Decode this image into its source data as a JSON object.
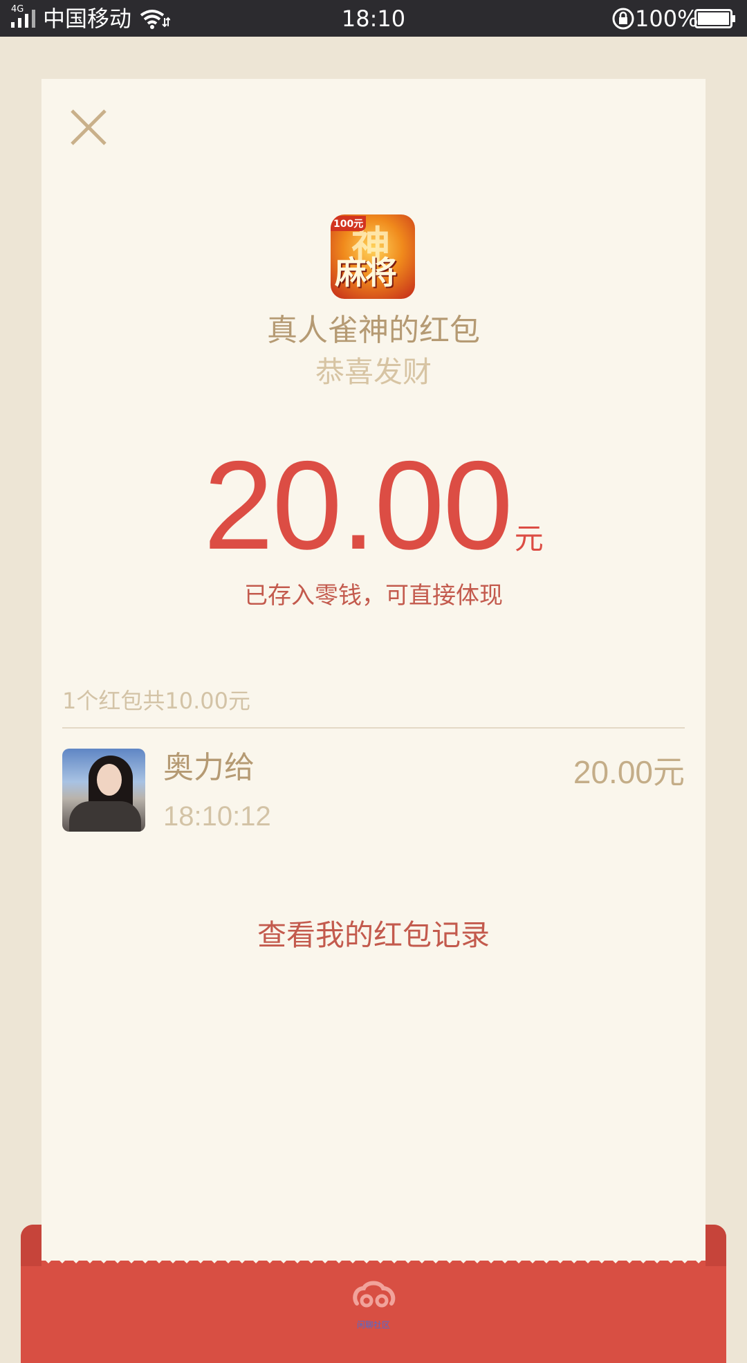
{
  "status_bar": {
    "network": "4G",
    "carrier": "中国移动",
    "time": "18:10",
    "battery_percent": "100%"
  },
  "close_icon": "close-icon",
  "sender": {
    "app_icon_badge": "100元",
    "app_icon_glyph_top": "神",
    "app_icon_glyph_bottom": "麻将",
    "title": "真人雀神的红包",
    "greeting": "恭喜发财"
  },
  "amount": {
    "value": "20.00",
    "unit": "元",
    "note": "已存入零钱，可直接体现"
  },
  "records": {
    "summary": "1个红包共10.00元",
    "items": [
      {
        "name": "奥力给",
        "time": "18:10:12",
        "amount": "20.00",
        "unit": "元"
      }
    ]
  },
  "view_records_link": "查看我的红包记录",
  "envelope": {
    "caption": "闲聊社区"
  },
  "colors": {
    "accent_red": "#dc4d44",
    "envelope_red": "#d84f43",
    "card_bg": "#faf6ec",
    "page_bg": "#ede5d5",
    "gold_text": "#b59a73"
  }
}
